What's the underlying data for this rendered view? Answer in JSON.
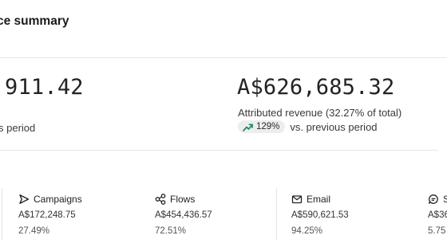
{
  "header": {
    "title": "ce summary"
  },
  "summary": {
    "left": {
      "amount": "911.42",
      "comparison_text": "s period"
    },
    "right": {
      "amount": "A$626,685.32",
      "label": "Attributed revenue (32.27% of total)",
      "change_pct": "129%",
      "comparison_text": "vs. previous period",
      "trend_color": "#1f8a5b"
    }
  },
  "channels": [
    {
      "name": "Campaigns",
      "icon": "send-icon",
      "value": "A$172,248.75",
      "share": "27.49%"
    },
    {
      "name": "Flows",
      "icon": "flow-icon",
      "value": "A$454,436.57",
      "share": "72.51%"
    },
    {
      "name": "Email",
      "icon": "mail-icon",
      "value": "A$590,621.53",
      "share": "94.25%"
    },
    {
      "name": "S",
      "icon": "sms-icon",
      "value": "A$36",
      "share": "5.75"
    }
  ]
}
